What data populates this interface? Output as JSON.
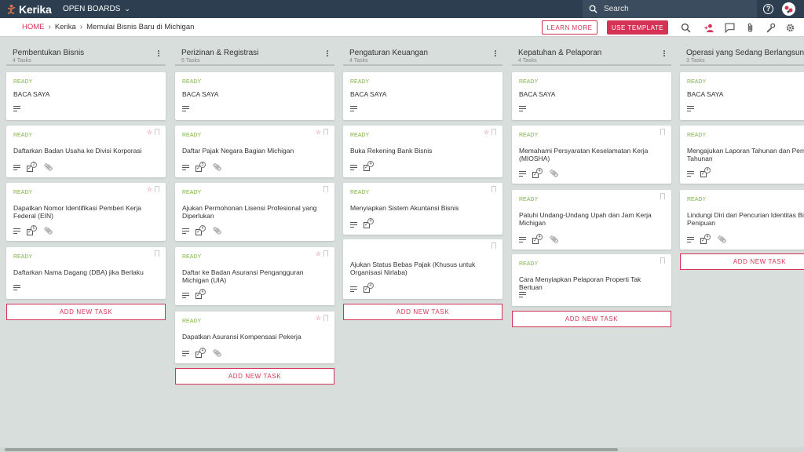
{
  "app": {
    "logo_text": "Kerika",
    "open_boards": "OPEN BOARDS"
  },
  "search": {
    "placeholder": "Search"
  },
  "breadcrumb": {
    "home": "HOME",
    "board": "Kerika",
    "page": "Memulai Bisnis Baru di Michigan"
  },
  "buttons": {
    "learn_more": "LEARN MORE",
    "use_template": "USE TEMPLATE",
    "add_task": "ADD NEW TASK"
  },
  "colors": {
    "accent": "#d43355",
    "topbar": "#2c3e50",
    "ready": "#7cb342",
    "background": "#d7dedb"
  },
  "columns": [
    {
      "title": "Pembentukan Bisnis",
      "count": "4 Tasks",
      "cards": [
        {
          "status": "READY",
          "title": "BACA SAYA",
          "star": false,
          "checklist": "",
          "attachment": false
        },
        {
          "status": "READY",
          "title": "Daftarkan Badan Usaha ke Divisi Korporasi",
          "star": true,
          "checklist": "2",
          "attachment": true
        },
        {
          "status": "READY",
          "title": "Dapatkan Nomor Identifikasi Pemberi Kerja Federal (EIN)",
          "star": true,
          "checklist": "6",
          "attachment": true
        },
        {
          "status": "READY",
          "title": "Daftarkan Nama Dagang (DBA) jika Berlaku",
          "star": false,
          "checklist": "",
          "attachment": false
        }
      ]
    },
    {
      "title": "Perizinan & Registrasi",
      "count": "5 Tasks",
      "cards": [
        {
          "status": "READY",
          "title": "BACA SAYA",
          "star": false,
          "checklist": "",
          "attachment": false
        },
        {
          "status": "READY",
          "title": "Daftar Pajak Negara Bagian Michigan",
          "star": true,
          "checklist": "5",
          "attachment": true
        },
        {
          "status": "READY",
          "title": "Ajukan Permohonan Lisensi Profesional yang Diperlukan",
          "star": false,
          "checklist": "4",
          "attachment": true
        },
        {
          "status": "READY",
          "title": "Daftar ke Badan Asuransi Pengangguran Michigan (UIA)",
          "star": true,
          "checklist": "4",
          "attachment": false
        },
        {
          "status": "READY",
          "title": "Dapatkan Asuransi Kompensasi Pekerja",
          "star": true,
          "checklist": "4",
          "attachment": true
        }
      ]
    },
    {
      "title": "Pengaturan Keuangan",
      "count": "4 Tasks",
      "cards": [
        {
          "status": "READY",
          "title": "BACA SAYA",
          "star": false,
          "checklist": "",
          "attachment": false
        },
        {
          "status": "READY",
          "title": "Buka Rekening Bank Bisnis",
          "star": true,
          "checklist": "4",
          "attachment": false
        },
        {
          "status": "READY",
          "title": "Menyiapkan Sistem Akuntansi Bisnis",
          "star": false,
          "checklist": "4",
          "attachment": false
        },
        {
          "status": "",
          "title": "Ajukan Status Bebas Pajak (Khusus untuk Organisasi Nirlaba)",
          "star": false,
          "checklist": "4",
          "attachment": false
        }
      ]
    },
    {
      "title": "Kepatuhan & Pelaporan",
      "count": "4 Tasks",
      "cards": [
        {
          "status": "READY",
          "title": "BACA SAYA",
          "star": false,
          "checklist": "",
          "attachment": false
        },
        {
          "status": "READY",
          "title": "Memahami Persyaratan Keselamatan Kerja (MIOSHA)",
          "star": false,
          "checklist": "4",
          "attachment": true
        },
        {
          "status": "READY",
          "title": "Patuhi Undang-Undang Upah dan Jam Kerja Michigan",
          "star": false,
          "checklist": "4",
          "attachment": true
        },
        {
          "status": "READY",
          "title": "Cara Menyiapkan Pelaporan Properti Tak Bertuan",
          "star": false,
          "checklist": "",
          "attachment": false
        }
      ]
    },
    {
      "title": "Operasi yang Sedang Berlangsung",
      "count": "3 Tasks",
      "cards": [
        {
          "status": "READY",
          "title": "BACA SAYA",
          "star": false,
          "checklist": "",
          "attachment": false
        },
        {
          "status": "READY",
          "title": "Mengajukan Laporan Tahunan dan Perny Tahunan",
          "star": false,
          "checklist": "4",
          "attachment": false
        },
        {
          "status": "READY",
          "title": "Lindungi Diri dari Pencurian Identitas Bis Penipuan",
          "star": false,
          "checklist": "4",
          "attachment": true
        }
      ]
    }
  ]
}
